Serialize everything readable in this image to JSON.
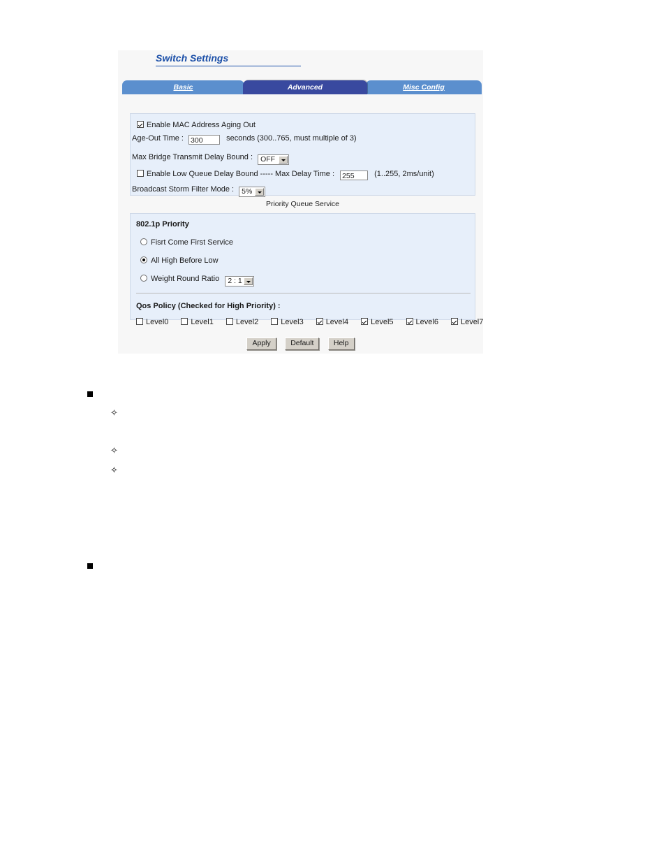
{
  "page": {
    "title": "Switch Settings"
  },
  "tabs": [
    {
      "id": "basic",
      "label": "Basic",
      "active": false
    },
    {
      "id": "advanced",
      "label": "Advanced",
      "active": true
    },
    {
      "id": "misc",
      "label": "Misc Config",
      "active": false
    }
  ],
  "aging_panel": {
    "enable_aging_label": "Enable MAC Address Aging Out",
    "enable_aging_checked": true,
    "age_out_label": "Age-Out Time :",
    "age_out_value": "300",
    "age_out_hint": "seconds (300..765, must multiple of 3)",
    "max_bridge_label": "Max Bridge Transmit Delay Bound :",
    "max_bridge_value": "OFF",
    "low_queue_label": "Enable Low Queue Delay Bound ----- Max Delay Time :",
    "low_queue_checked": false,
    "max_delay_value": "255",
    "max_delay_hint": "(1..255, 2ms/unit)",
    "storm_filter_label": "Broadcast Storm Filter Mode :",
    "storm_filter_value": "5%"
  },
  "queue_service": {
    "caption": "Priority Queue Service",
    "heading": "802.1p Priority",
    "options": [
      {
        "id": "fcfs",
        "label": "Fisrt Come First Service",
        "selected": false
      },
      {
        "id": "ahbl",
        "label": "All High Before Low",
        "selected": true
      },
      {
        "id": "wrr",
        "label": "Weight Round Ratio",
        "selected": false
      }
    ],
    "weight_ratio_value": "2 : 1"
  },
  "qos_policy": {
    "heading": "Qos Policy (Checked for High Priority) :",
    "levels": [
      {
        "label": "Level0",
        "checked": false
      },
      {
        "label": "Level1",
        "checked": false
      },
      {
        "label": "Level2",
        "checked": false
      },
      {
        "label": "Level3",
        "checked": false
      },
      {
        "label": "Level4",
        "checked": true
      },
      {
        "label": "Level5",
        "checked": true
      },
      {
        "label": "Level6",
        "checked": true
      },
      {
        "label": "Level7",
        "checked": true
      }
    ]
  },
  "buttons": {
    "apply": "Apply",
    "default": "Default",
    "help": "Help"
  },
  "bullets": {
    "square_glyph": "",
    "diamond_glyph": "✧"
  },
  "colors": {
    "title_blue": "#1b4fa8",
    "tab_inactive": "#5b8fce",
    "tab_active": "#39499f",
    "panel_bg": "#e7effa",
    "window_bg": "#f7f7f7"
  }
}
